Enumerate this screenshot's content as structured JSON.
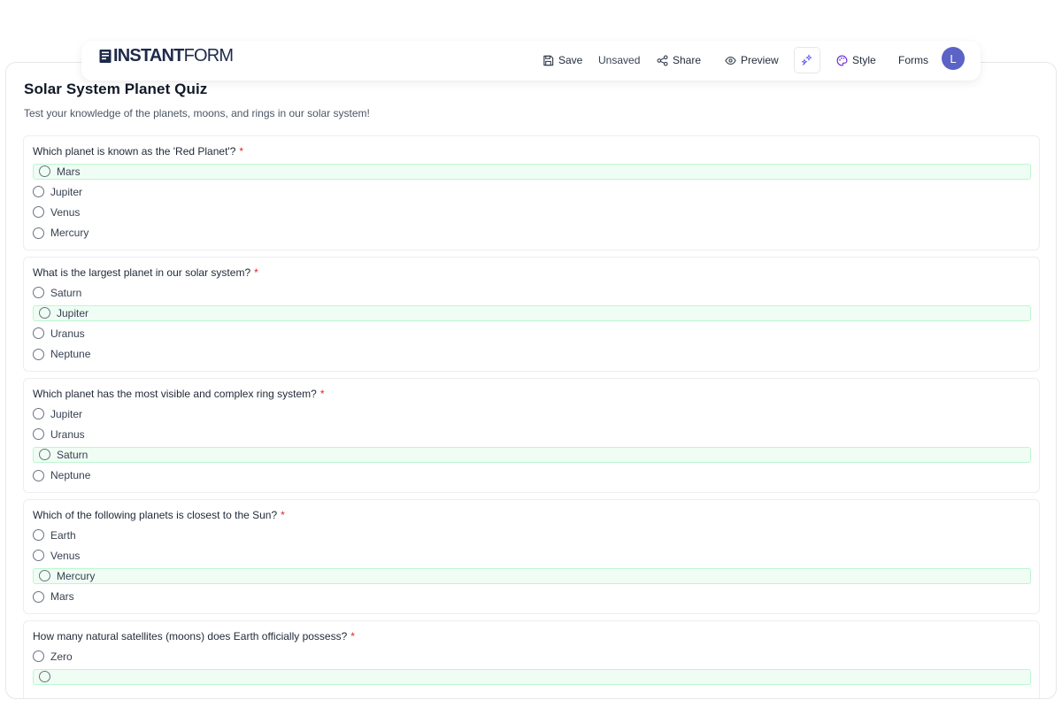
{
  "brand": {
    "logo_bold": "INSTANT",
    "logo_light": "FORM"
  },
  "toolbar": {
    "save_label": "Save",
    "status_label": "Unsaved",
    "share_label": "Share",
    "preview_label": "Preview",
    "style_label": "Style",
    "forms_label": "Forms",
    "avatar_initial": "L"
  },
  "form": {
    "title": "Solar System Planet Quiz",
    "description": "Test your knowledge of the planets, moons, and rings in our solar system!",
    "required_mark": "*",
    "questions": [
      {
        "text": "Which planet is known as the 'Red Planet'?",
        "options": [
          "Mars",
          "Jupiter",
          "Venus",
          "Mercury"
        ],
        "correct_index": 0
      },
      {
        "text": "What is the largest planet in our solar system?",
        "options": [
          "Saturn",
          "Jupiter",
          "Uranus",
          "Neptune"
        ],
        "correct_index": 1
      },
      {
        "text": "Which planet has the most visible and complex ring system?",
        "options": [
          "Jupiter",
          "Uranus",
          "Saturn",
          "Neptune"
        ],
        "correct_index": 2
      },
      {
        "text": "Which of the following planets is closest to the Sun?",
        "options": [
          "Earth",
          "Venus",
          "Mercury",
          "Mars"
        ],
        "correct_index": 2
      },
      {
        "text": "How many natural satellites (moons) does Earth officially possess?",
        "options": [
          "Zero",
          ""
        ],
        "correct_index": 1
      }
    ]
  },
  "colors": {
    "accent": "#5b63c6",
    "correct_bg": "#f0fdf4",
    "correct_border": "#bbf7d0",
    "required": "#dc2626"
  }
}
